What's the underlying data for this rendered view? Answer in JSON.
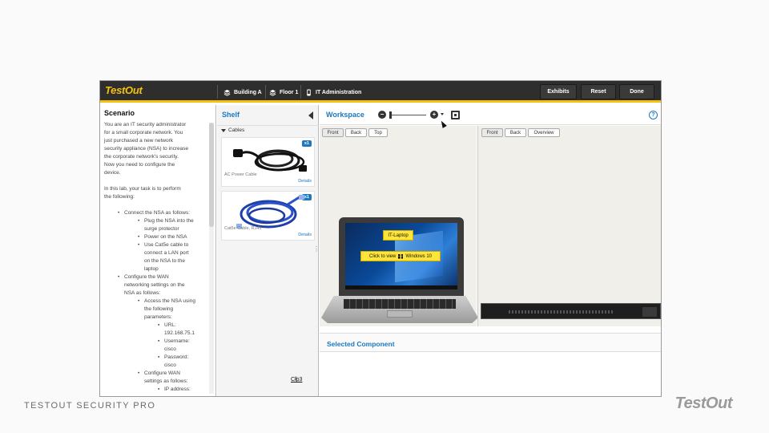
{
  "app": {
    "brand": "TestOut",
    "breadcrumbs": [
      {
        "label": "Building A",
        "icon": "layers-icon"
      },
      {
        "label": "Floor 1",
        "icon": "layers-icon"
      },
      {
        "label": "IT Administration",
        "icon": "phone-icon"
      }
    ],
    "buttons": {
      "exhibits": "Exhibits",
      "reset": "Reset",
      "done": "Done"
    }
  },
  "scenario": {
    "title": "Scenario",
    "intro": [
      "You are an IT security administrator",
      "for a small corporate network. You",
      "just purchased a new network",
      "security appliance (NSA) to increase",
      "the corporate network's security.",
      "Now you need to configure the",
      "device."
    ],
    "task_lead": [
      "In this lab, your task is to perform",
      "the following:"
    ],
    "bullets": [
      {
        "level": 1,
        "lines": [
          "Connect the NSA as follows:"
        ]
      },
      {
        "level": 2,
        "lines": [
          "Plug the NSA into the",
          "surge protector"
        ]
      },
      {
        "level": 2,
        "lines": [
          "Power on the NSA"
        ]
      },
      {
        "level": 2,
        "lines": [
          "Use Cat5e cable to",
          "connect a LAN port",
          "on the NSA to the",
          "laptop"
        ]
      },
      {
        "level": 1,
        "lines": [
          "Configure the WAN",
          "networking settings on the",
          "NSA as follows:"
        ]
      },
      {
        "level": 2,
        "lines": [
          "Access the NSA using",
          "the following",
          "parameters:"
        ]
      },
      {
        "level": 3,
        "lines": [
          "URL:",
          "192.168.75.1"
        ]
      },
      {
        "level": 3,
        "lines": [
          "Username:",
          "cisco"
        ]
      },
      {
        "level": 3,
        "lines": [
          "Password:",
          "cisco"
        ]
      },
      {
        "level": 2,
        "lines": [
          "Configure WAN",
          "settings as follows:"
        ]
      },
      {
        "level": 3,
        "lines": [
          "IP address:"
        ]
      }
    ]
  },
  "shelf": {
    "title": "Shelf",
    "category": "Cables",
    "items": [
      {
        "name": "AC Power Cable",
        "qty": "x1",
        "details": "Details"
      },
      {
        "name": "Cat5e Cable, RJ45",
        "qty": "x1",
        "details": "Details"
      }
    ]
  },
  "workspace": {
    "title": "Workspace",
    "zoom_out": "−",
    "zoom_in": "+",
    "left_views": [
      "Front",
      "Back",
      "Top"
    ],
    "right_views": [
      "Front",
      "Back",
      "Overview"
    ],
    "laptop_label": "IT-Laptop",
    "laptop_action": "Click to view",
    "laptop_os": "Windows 10",
    "selected_title": "Selected Component",
    "help": "?"
  },
  "cursor_text": "Cl̸p3",
  "footer": {
    "left": "TESTOUT SECURITY PRO",
    "logo": "TestOut"
  },
  "colors": {
    "accent": "#f4c20d",
    "link": "#1b78c1",
    "topbar": "#2e2e2e"
  }
}
